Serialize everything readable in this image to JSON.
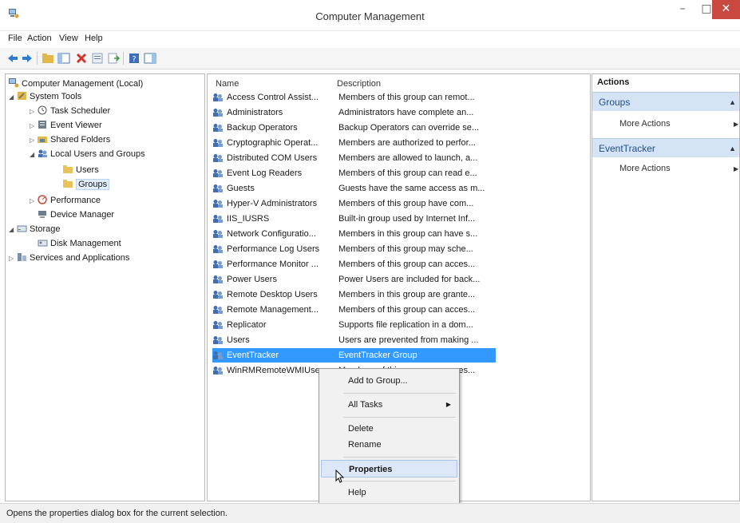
{
  "window": {
    "title": "Computer Management",
    "minimize": "–",
    "maximize": "□",
    "close": "✕"
  },
  "menu": [
    "File",
    "Action",
    "View",
    "Help"
  ],
  "toolbar": {
    "icons": [
      "back-arrow-icon",
      "forward-arrow-icon",
      "folder-up-icon",
      "show-hide-tree-icon",
      "delete-icon",
      "properties-icon",
      "export-list-icon",
      "help-icon",
      "show-action-pane-icon"
    ]
  },
  "tree": [
    {
      "label": "Computer Management (Local)",
      "level": 0,
      "toggle": "",
      "icon": "computer-management-icon"
    },
    {
      "label": "System Tools",
      "level": 1,
      "toggle": "◢",
      "icon": "tools-icon"
    },
    {
      "label": "Task Scheduler",
      "level": 2,
      "toggle": "▷",
      "icon": "clock-icon"
    },
    {
      "label": "Event Viewer",
      "level": 2,
      "toggle": "▷",
      "icon": "event-viewer-icon"
    },
    {
      "label": "Shared Folders",
      "level": 2,
      "toggle": "▷",
      "icon": "shared-folder-icon"
    },
    {
      "label": "Local Users and Groups",
      "level": 2,
      "toggle": "◢",
      "icon": "users-groups-icon"
    },
    {
      "label": "Users",
      "level": 3,
      "toggle": "",
      "icon": "folder-icon"
    },
    {
      "label": "Groups",
      "level": 3,
      "toggle": "",
      "icon": "folder-icon",
      "selected": true
    },
    {
      "label": "Performance",
      "level": 2,
      "toggle": "▷",
      "icon": "performance-icon"
    },
    {
      "label": "Device Manager",
      "level": 2,
      "toggle": "",
      "icon": "device-manager-icon"
    },
    {
      "label": "Storage",
      "level": 1,
      "toggle": "◢",
      "icon": "storage-icon"
    },
    {
      "label": "Disk Management",
      "level": 2,
      "toggle": "",
      "icon": "disk-icon"
    },
    {
      "label": "Services and Applications",
      "level": 1,
      "toggle": "▷",
      "icon": "services-icon"
    }
  ],
  "list": {
    "headers": {
      "name": "Name",
      "description": "Description"
    },
    "rows": [
      {
        "name": "Access Control Assist...",
        "description": "Members of this group can remot..."
      },
      {
        "name": "Administrators",
        "description": "Administrators have complete an..."
      },
      {
        "name": "Backup Operators",
        "description": "Backup Operators can override se..."
      },
      {
        "name": "Cryptographic Operat...",
        "description": "Members are authorized to perfor..."
      },
      {
        "name": "Distributed COM Users",
        "description": "Members are allowed to launch, a..."
      },
      {
        "name": "Event Log Readers",
        "description": "Members of this group can read e..."
      },
      {
        "name": "Guests",
        "description": "Guests have the same access as m..."
      },
      {
        "name": "Hyper-V Administrators",
        "description": "Members of this group have com..."
      },
      {
        "name": "IIS_IUSRS",
        "description": "Built-in group used by Internet Inf..."
      },
      {
        "name": "Network Configuratio...",
        "description": "Members in this group can have s..."
      },
      {
        "name": "Performance Log Users",
        "description": "Members of this group may sche..."
      },
      {
        "name": "Performance Monitor ...",
        "description": "Members of this group can acces..."
      },
      {
        "name": "Power Users",
        "description": "Power Users are included for back..."
      },
      {
        "name": "Remote Desktop Users",
        "description": "Members in this group are grante..."
      },
      {
        "name": "Remote Management...",
        "description": "Members of this group can acces..."
      },
      {
        "name": "Replicator",
        "description": "Supports file replication in a dom..."
      },
      {
        "name": "Users",
        "description": "Users are prevented from making ..."
      },
      {
        "name": "EventTracker",
        "description": "EventTracker Group",
        "selected": true
      },
      {
        "name": "WinRMRemoteWMIUsers__",
        "description": "Members of this group can acces..."
      }
    ]
  },
  "actions": {
    "header": "Actions",
    "groups": [
      {
        "title": "Groups",
        "link": "More Actions"
      },
      {
        "title": "EventTracker",
        "link": "More Actions"
      }
    ]
  },
  "context_menu": [
    {
      "label": "Add to Group..."
    },
    {
      "label": "All Tasks",
      "submenu": "▶"
    },
    {
      "label": "Delete"
    },
    {
      "label": "Rename"
    },
    {
      "label": "Properties",
      "highlighted": true,
      "bold": true
    },
    {
      "label": "Help"
    }
  ],
  "status": "Opens the properties dialog box for the current selection.",
  "colors": {
    "selection": "#3399ff",
    "action_group_bg": "#d5e4f5",
    "close_button": "#c9483f",
    "menu_highlight": "#dce8f7"
  }
}
